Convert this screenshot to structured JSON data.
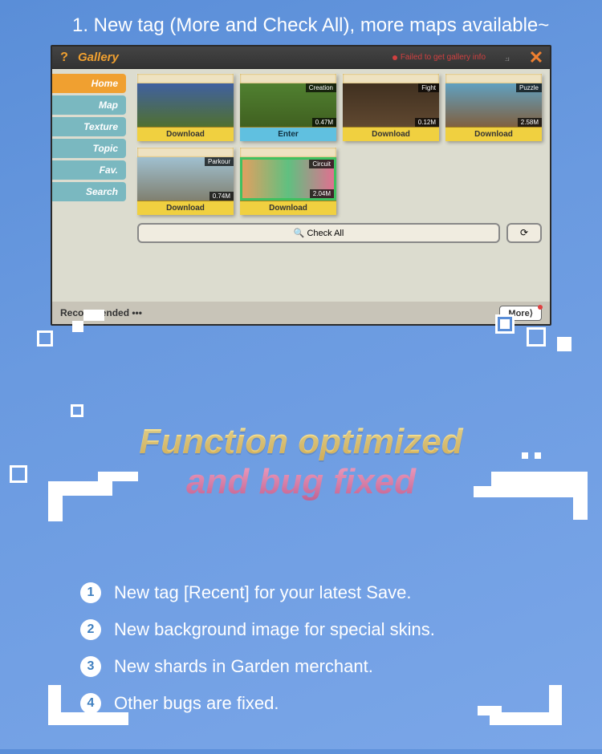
{
  "caption": "1. New tag (More and Check All), more maps available~",
  "window": {
    "title": "Gallery",
    "status": "Failed to get gallery info",
    "sidebar": [
      {
        "label": "Home",
        "active": true
      },
      {
        "label": "Map",
        "active": false
      },
      {
        "label": "Texture",
        "active": false
      },
      {
        "label": "Topic",
        "active": false
      },
      {
        "label": "Fav.",
        "active": false
      },
      {
        "label": "Search",
        "active": false
      }
    ],
    "cards": [
      {
        "tag": "",
        "size": "",
        "btn": "Download"
      },
      {
        "tag": "Creation",
        "size": "0.47M",
        "btn": "Enter",
        "enter": true
      },
      {
        "tag": "Fight",
        "size": "0.12M",
        "btn": "Download"
      },
      {
        "tag": "Puzzle",
        "size": "2.58M",
        "btn": "Download"
      },
      {
        "tag": "Parkour",
        "size": "0.74M",
        "btn": "Download"
      },
      {
        "tag": "Circuit",
        "size": "2.04M",
        "btn": "Download"
      }
    ],
    "check_all": "🔍 Check All",
    "refresh": "⟳",
    "recommended": "Recommended •••",
    "more": "More⟩"
  },
  "heading": {
    "line1": "Function optimized",
    "line2": "and bug fixed"
  },
  "bullets": [
    "New tag [Recent] for your latest Save.",
    "New background image for special skins.",
    "New shards in Garden merchant.",
    "Other bugs are fixed."
  ]
}
